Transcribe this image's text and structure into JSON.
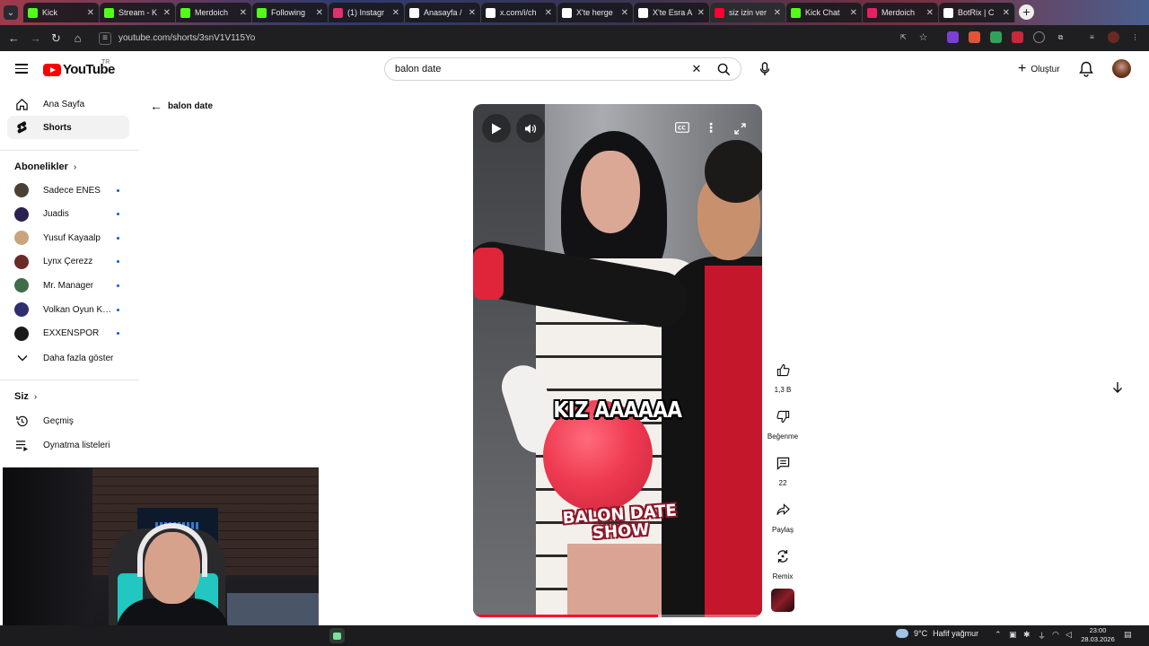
{
  "browser": {
    "tabs": [
      {
        "title": "Kick",
        "favicon": "kick-icon",
        "color": "#53fc18"
      },
      {
        "title": "Stream - K",
        "favicon": "kick-icon",
        "color": "#53fc18"
      },
      {
        "title": "Merdoich",
        "favicon": "kick-icon",
        "color": "#53fc18"
      },
      {
        "title": "Following",
        "favicon": "kick-icon",
        "color": "#53fc18"
      },
      {
        "title": "(1) Instagr",
        "favicon": "instagram-icon",
        "color": "#e1306c"
      },
      {
        "title": "Anasayfa /",
        "favicon": "x-icon",
        "color": "#ffffff"
      },
      {
        "title": "x.com/i/ch",
        "favicon": "x-icon",
        "color": "#ffffff"
      },
      {
        "title": "X'te herge",
        "favicon": "x-icon",
        "color": "#ffffff"
      },
      {
        "title": "X'te Esra A",
        "favicon": "x-icon",
        "color": "#ffffff"
      },
      {
        "title": "siz izin ver",
        "favicon": "youtube-icon",
        "color": "#ff0033"
      },
      {
        "title": "Kick Chat",
        "favicon": "kick-chat-icon",
        "color": "#53fc18"
      },
      {
        "title": "Merdoich",
        "favicon": "twitch-icon",
        "color": "#e91e63"
      },
      {
        "title": "BotRix | C",
        "favicon": "botrix-icon",
        "color": "#ffffff"
      }
    ],
    "active_tab_index": 9,
    "url": "youtube.com/shorts/3snV1V115Yo"
  },
  "header": {
    "logo_text": "YouTube",
    "country_code": "TR",
    "search_query": "balon date",
    "create_label": "Oluştur"
  },
  "sidebar": {
    "main": [
      {
        "label": "Ana Sayfa",
        "icon": "home-icon"
      },
      {
        "label": "Shorts",
        "icon": "shorts-icon"
      }
    ],
    "subscriptions_title": "Abonelikler",
    "subscriptions": [
      {
        "name": "Sadece ENES",
        "avatar_color": "#4b4036"
      },
      {
        "name": "Juadis",
        "avatar_color": "#2a2150"
      },
      {
        "name": "Yusuf Kayaalp",
        "avatar_color": "#c9a57e"
      },
      {
        "name": "Lynx Çerezz",
        "avatar_color": "#6b2a28"
      },
      {
        "name": "Mr. Manager",
        "avatar_color": "#3f6d4a"
      },
      {
        "name": "Volkan Oyun Kuv...",
        "avatar_color": "#2e2e70"
      },
      {
        "name": "EXXENSPOR",
        "avatar_color": "#1a1a1a"
      }
    ],
    "show_more": "Daha fazla göster",
    "you_title": "Siz",
    "you_items": [
      {
        "label": "Geçmiş",
        "icon": "history-icon"
      },
      {
        "label": "Oynatma listeleri",
        "icon": "playlists-icon"
      }
    ]
  },
  "main": {
    "back_label": "balon date",
    "caption": "KIZ AAAAAA",
    "badge_line1": "BALON DATE",
    "badge_line2": "SHOW",
    "progress": 0.64,
    "actions": [
      {
        "label": "1,3 B",
        "icon": "like-icon"
      },
      {
        "label": "Beğenme",
        "icon": "dislike-icon"
      },
      {
        "label": "22",
        "icon": "comment-icon"
      },
      {
        "label": "Paylaş",
        "icon": "share-icon"
      },
      {
        "label": "Remix",
        "icon": "remix-icon"
      }
    ]
  },
  "taskbar": {
    "temperature": "9°C",
    "weather_text": "Hafif yağmur",
    "time": "23:00",
    "date": "28.03.2026"
  }
}
